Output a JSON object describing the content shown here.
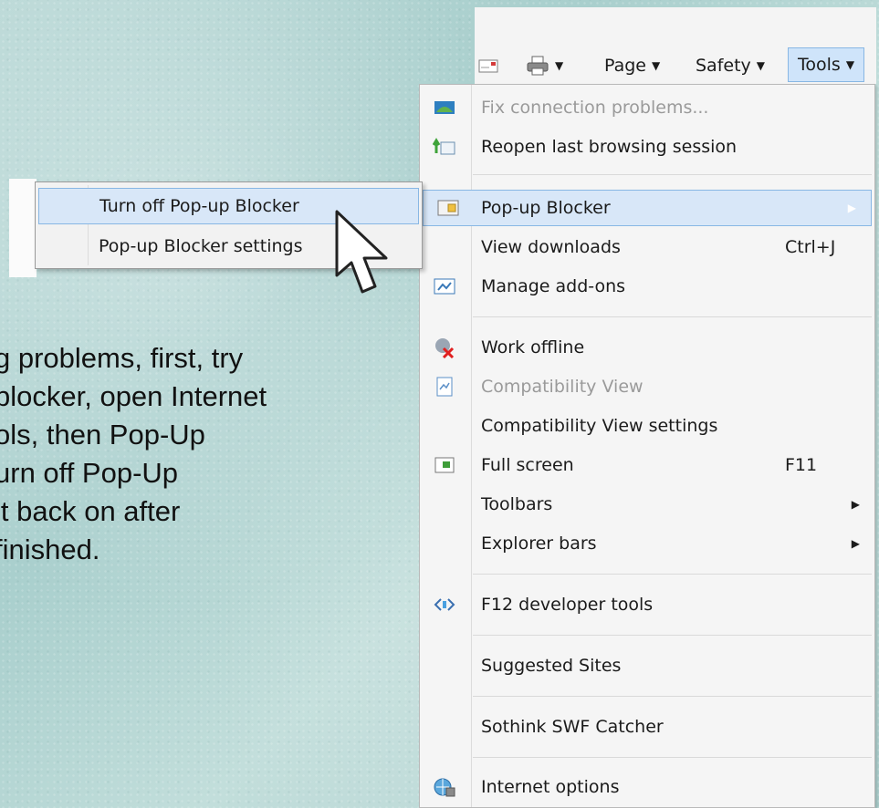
{
  "slide_text": {
    "lines": [
      "g problems, first, try",
      "blocker, open Internet",
      "ols, then Pop-Up",
      "urn off Pop-Up",
      " it back on after",
      "finished."
    ]
  },
  "command_bar": {
    "page_label": "Page",
    "safety_label": "Safety",
    "tools_label": "Tools",
    "dropdown_glyph": "▼"
  },
  "menu": {
    "items": [
      {
        "label": "Fix connection problems...",
        "disabled": true,
        "icon": "network-diagnose-icon"
      },
      {
        "label": "Reopen last browsing session",
        "icon": "reopen-session-icon"
      },
      {
        "label": "Pop-up Blocker",
        "icon": "popup-blocker-icon",
        "submenu": true,
        "highlighted": true
      },
      {
        "label": "View downloads",
        "shortcut": "Ctrl+J"
      },
      {
        "label": "Manage add-ons",
        "icon": "addons-icon"
      },
      {
        "label": "Work offline",
        "icon": "work-offline-icon"
      },
      {
        "label": "Compatibility View",
        "disabled": true,
        "icon": "compatibility-view-icon"
      },
      {
        "label": "Compatibility View settings"
      },
      {
        "label": "Full screen",
        "shortcut": "F11",
        "icon": "fullscreen-icon"
      },
      {
        "label": "Toolbars",
        "submenu": true
      },
      {
        "label": "Explorer bars",
        "submenu": true
      },
      {
        "label": "F12 developer tools",
        "icon": "developer-tools-icon"
      },
      {
        "label": "Suggested Sites"
      },
      {
        "label": "Sothink SWF Catcher"
      },
      {
        "label": "Internet options",
        "icon": "internet-options-icon"
      }
    ],
    "submenu_arrow": "▶"
  },
  "submenu": {
    "items": [
      {
        "label": "Turn off Pop-up Blocker",
        "highlighted": true
      },
      {
        "label": "Pop-up Blocker settings"
      }
    ]
  },
  "colors": {
    "highlight_fill": "#d8e7f8",
    "highlight_border": "#88b7e4",
    "disabled_text": "#9a9a9a"
  }
}
